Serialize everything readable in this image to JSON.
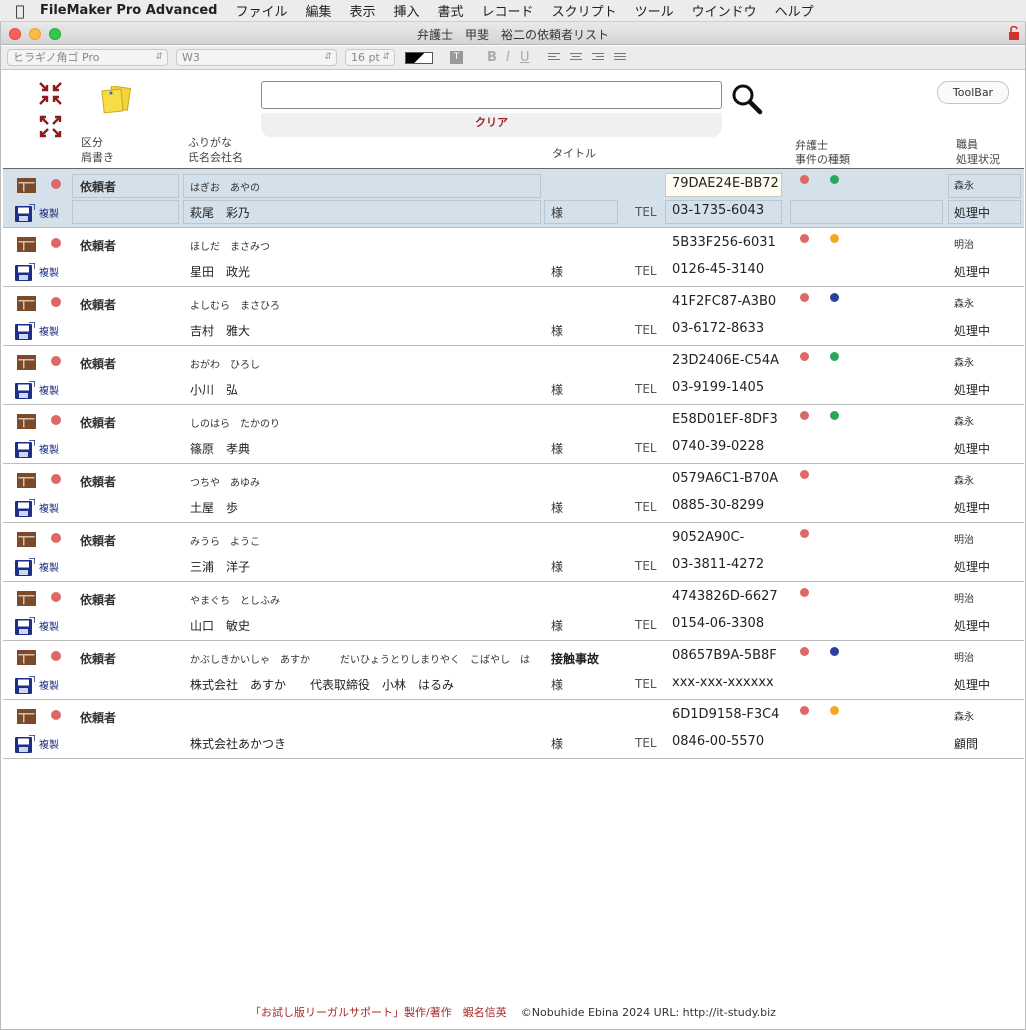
{
  "menubar": {
    "app_name": "FileMaker Pro Advanced",
    "items": [
      "ファイル",
      "編集",
      "表示",
      "挿入",
      "書式",
      "レコード",
      "スクリプト",
      "ツール",
      "ウインドウ",
      "ヘルプ"
    ]
  },
  "window": {
    "title": "弁護士　甲斐　裕二の依頼者リスト"
  },
  "formatbar": {
    "font": "ヒラギノ角ゴ Pro",
    "weight": "W3",
    "size": "16 pt"
  },
  "header": {
    "search_value": "",
    "clear_label": "クリア",
    "toolbar_label": "ToolBar",
    "columns": {
      "kubun": "区分",
      "katagaki": "肩書き",
      "furigana": "ふりがな",
      "name": "氏名会社名",
      "title": "タイトル",
      "lawyer": "弁護士",
      "case_type": "事件の種類",
      "staff": "職員",
      "status": "処理状況"
    }
  },
  "labels": {
    "duplicate": "複製",
    "tel": "TEL",
    "honorific": "様"
  },
  "colors": {
    "red_dot": "#de6767",
    "green_dot": "#2aa65b",
    "orange_dot": "#f5a623",
    "blue_dot": "#2d3f9a",
    "active_row": "#d4e1ea"
  },
  "records": [
    {
      "kubun": "依頼者",
      "furigana": "はぎお　あやの",
      "name": "萩尾　彩乃",
      "title": "",
      "id": "79DAE24E-BB72",
      "phone": "03-1735-6043",
      "case_dot": "green",
      "staff": "森永",
      "status": "処理中",
      "active": true
    },
    {
      "kubun": "依頼者",
      "furigana": "ほしだ　まさみつ",
      "name": "星田　政光",
      "title": "",
      "id": "5B33F256-6031",
      "phone": "0126-45-3140",
      "case_dot": "orange",
      "staff": "明治",
      "status": "処理中",
      "active": false
    },
    {
      "kubun": "依頼者",
      "furigana": "よしむら　まさひろ",
      "name": "吉村　雅大",
      "title": "",
      "id": "41F2FC87-A3B0",
      "phone": "03-6172-8633",
      "case_dot": "blue",
      "staff": "森永",
      "status": "処理中",
      "active": false
    },
    {
      "kubun": "依頼者",
      "furigana": "おがわ　ひろし",
      "name": "小川　弘",
      "title": "",
      "id": "23D2406E-C54A",
      "phone": "03-9199-1405",
      "case_dot": "green",
      "staff": "森永",
      "status": "処理中",
      "active": false
    },
    {
      "kubun": "依頼者",
      "furigana": "しのはら　たかのり",
      "name": "篠原　孝典",
      "title": "",
      "id": "E58D01EF-8DF3",
      "phone": "0740-39-0228",
      "case_dot": "green",
      "staff": "森永",
      "status": "処理中",
      "active": false
    },
    {
      "kubun": "依頼者",
      "furigana": "つちや　あゆみ",
      "name": "土屋　歩",
      "title": "",
      "id": "0579A6C1-B70A",
      "phone": "0885-30-8299",
      "case_dot": "",
      "staff": "森永",
      "status": "処理中",
      "active": false
    },
    {
      "kubun": "依頼者",
      "furigana": "みうら　ようこ",
      "name": "三浦　洋子",
      "title": "",
      "id": "9052A90C-",
      "phone": "03-3811-4272",
      "case_dot": "",
      "staff": "明治",
      "status": "処理中",
      "active": false
    },
    {
      "kubun": "依頼者",
      "furigana": "やまぐち　としふみ",
      "name": "山口　敏史",
      "title": "",
      "id": "4743826D-6627",
      "phone": "0154-06-3308",
      "case_dot": "",
      "staff": "明治",
      "status": "処理中",
      "active": false
    },
    {
      "kubun": "依頼者",
      "furigana": "かぶしきかいしゃ　あすか　　　だいひょうとりしまりやく　こばやし　は",
      "name": "株式会社　あすか　　代表取締役　小林　はるみ",
      "title": "接触事故",
      "id": "08657B9A-5B8F",
      "phone": "xxx-xxx-xxxxxx",
      "case_dot": "blue",
      "staff": "明治",
      "status": "処理中",
      "active": false
    },
    {
      "kubun": "依頼者",
      "furigana": "",
      "name": "株式会社あかつき",
      "title": "",
      "id": "6D1D9158-F3C4",
      "phone": "0846-00-5570",
      "case_dot": "orange",
      "staff": "森永",
      "status": "顧問",
      "active": false
    }
  ],
  "footer": {
    "product": "「お試し版リーガルサポート」製作/著作　蝦名信英",
    "copyright": "©Nobuhide Ebina 2024 URL: http://it-study.biz"
  }
}
